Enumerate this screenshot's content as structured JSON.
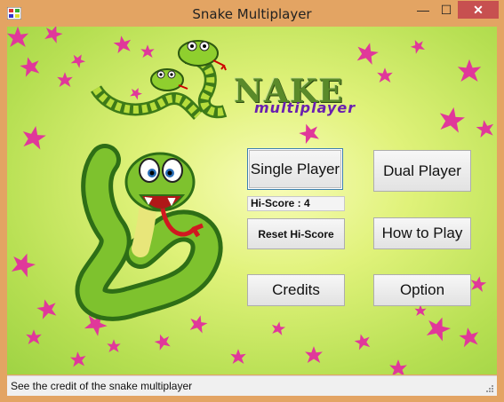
{
  "window": {
    "title": "Snake Multiplayer",
    "minimize": "—",
    "maximize": "☐",
    "close": "✕"
  },
  "logo": {
    "word": "NAKE",
    "sub": "multiplayer"
  },
  "buttons": {
    "single_player": "Single Player",
    "dual_player": "Dual Player",
    "reset_hiscore": "Reset Hi-Score",
    "how_to_play": "How to Play",
    "credits": "Credits",
    "option": "Option"
  },
  "hiscore": "Hi-Score : 4",
  "status": "See the credit of the snake multiplayer",
  "colors": {
    "accent_button_border": "#3c7fb1",
    "close": "#c75050",
    "leaf": "#e0389a",
    "background": "#b6df52"
  }
}
